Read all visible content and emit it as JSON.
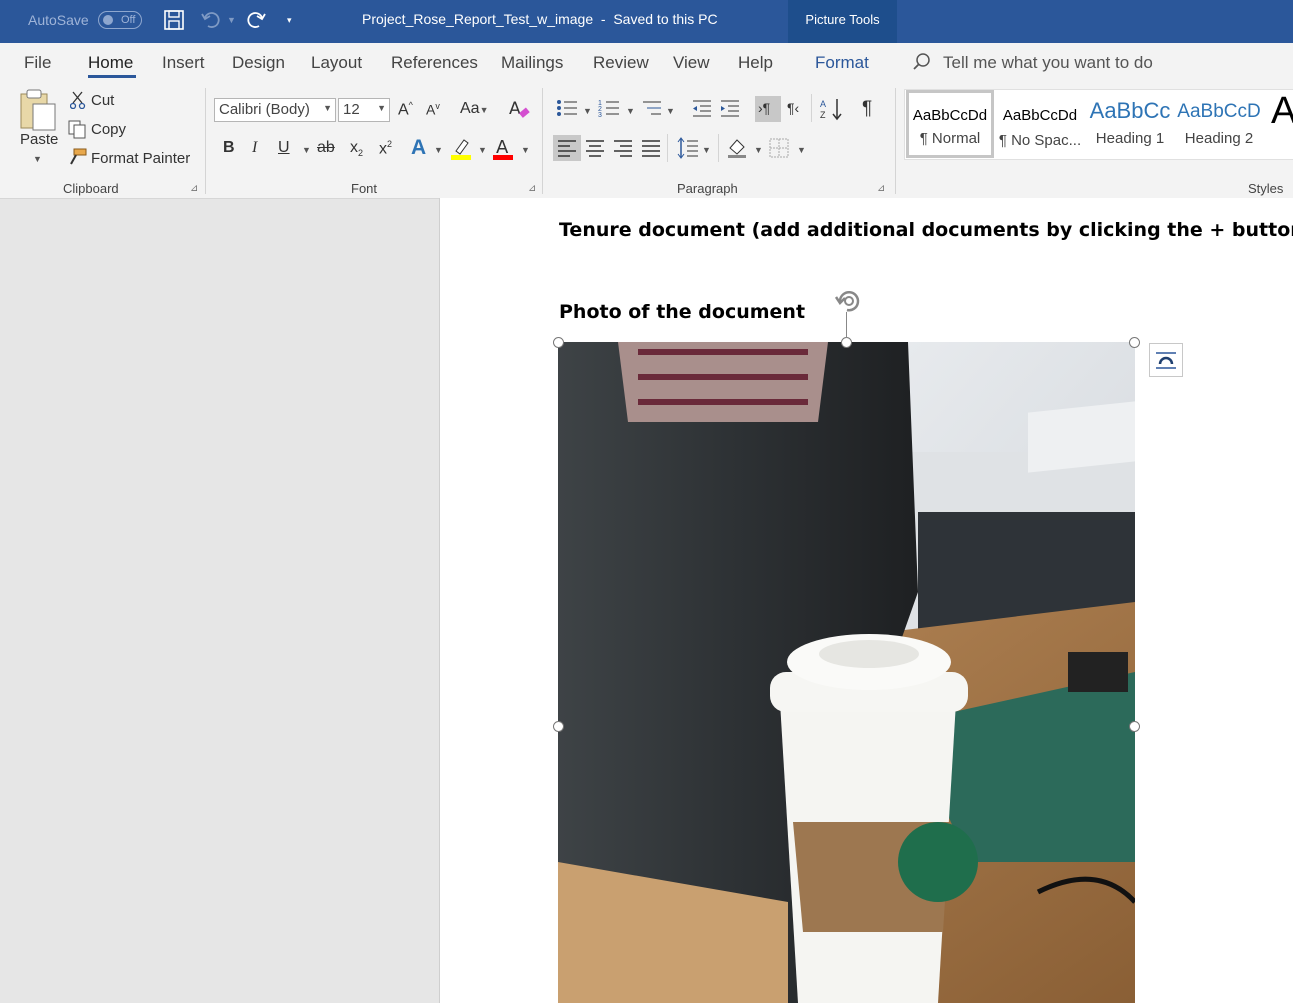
{
  "titlebar": {
    "autosave_label": "AutoSave",
    "autosave_state": "Off",
    "document_title": "Project_Rose_Report_Test_w_image  -  Saved to this PC",
    "contextual_tab_group": "Picture Tools"
  },
  "tabs": [
    "File",
    "Home",
    "Insert",
    "Design",
    "Layout",
    "References",
    "Mailings",
    "Review",
    "View",
    "Help",
    "Format"
  ],
  "active_tab": "Home",
  "tell_me_placeholder": "Tell me what you want to do",
  "clipboard": {
    "paste": "Paste",
    "cut": "Cut",
    "copy": "Copy",
    "format_painter": "Format Painter",
    "label": "Clipboard"
  },
  "font": {
    "font_name": "Calibri (Body)",
    "font_size": "12",
    "change_case": "Aa",
    "bold": "B",
    "italic": "I",
    "underline": "U",
    "strike": "ab",
    "label": "Font"
  },
  "paragraph": {
    "label": "Paragraph"
  },
  "styles": {
    "label": "Styles",
    "items": [
      {
        "preview": "AaBbCcDd",
        "name": "¶ Normal"
      },
      {
        "preview": "AaBbCcDd",
        "name": "¶ No Spac..."
      },
      {
        "preview": "AaBbCc",
        "name": "Heading 1"
      },
      {
        "preview": "AaBbCcD",
        "name": "Heading 2"
      },
      {
        "preview": "A",
        "name": ""
      }
    ]
  },
  "document": {
    "heading1": "Tenure document (add additional documents by clicking the + button)",
    "heading2": "Photo of the document"
  },
  "colors": {
    "titlebar": "#2b579a",
    "highlight_yellow": "#ffff00",
    "font_red": "#ff0000",
    "accent": "#2b579a"
  }
}
